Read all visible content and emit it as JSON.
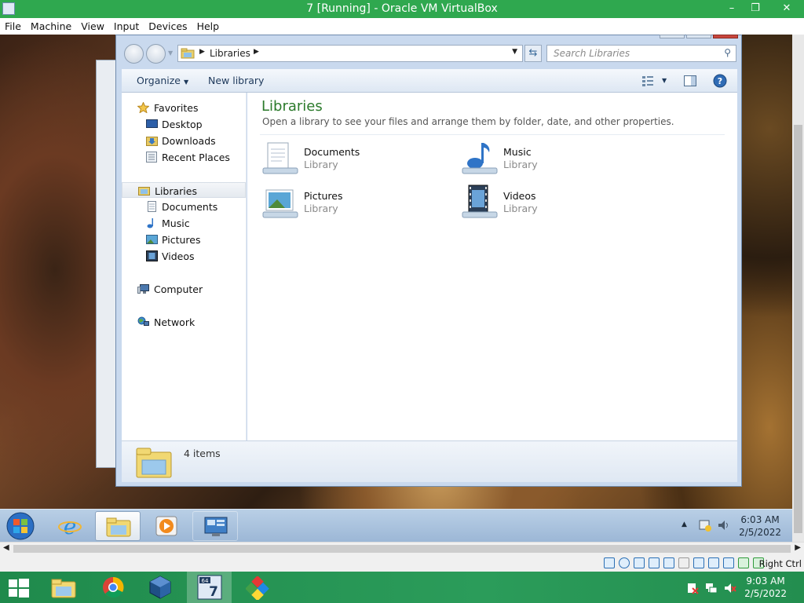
{
  "host": {
    "title": "7 [Running] - Oracle VM VirtualBox",
    "window_buttons": {
      "minimize": "–",
      "restore": "❐",
      "close": "✕"
    },
    "menu": [
      "File",
      "Machine",
      "View",
      "Input",
      "Devices",
      "Help"
    ],
    "status_key": "Right Ctrl",
    "clock": {
      "time": "9:03 AM",
      "date": "2/5/2022"
    }
  },
  "explorer": {
    "breadcrumb": "Libraries",
    "search_placeholder": "Search Libraries",
    "toolbar": {
      "organize": "Organize",
      "new_library": "New library"
    },
    "nav": {
      "favorites": "Favorites",
      "favorites_items": [
        "Desktop",
        "Downloads",
        "Recent Places"
      ],
      "libraries": "Libraries",
      "libraries_items": [
        "Documents",
        "Music",
        "Pictures",
        "Videos"
      ],
      "computer": "Computer",
      "network": "Network"
    },
    "content": {
      "title": "Libraries",
      "subtitle": "Open a library to see your files and arrange them by folder, date, and other properties.",
      "libraries": [
        {
          "name": "Documents",
          "type": "Library",
          "icon": "documents-library-icon"
        },
        {
          "name": "Music",
          "type": "Library",
          "icon": "music-library-icon"
        },
        {
          "name": "Pictures",
          "type": "Library",
          "icon": "pictures-library-icon"
        },
        {
          "name": "Videos",
          "type": "Library",
          "icon": "videos-library-icon"
        }
      ]
    },
    "details": {
      "count": "4 items"
    }
  },
  "guest": {
    "clock": {
      "time": "6:03 AM",
      "date": "2/5/2022"
    }
  }
}
